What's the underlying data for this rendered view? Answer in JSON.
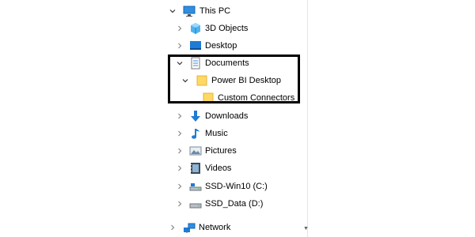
{
  "nav_tree": {
    "this_pc": "This PC",
    "items": [
      {
        "label": "3D Objects",
        "icon": "3d-objects-icon"
      },
      {
        "label": "Desktop",
        "icon": "desktop-icon"
      },
      {
        "label": "Documents",
        "icon": "documents-icon"
      },
      {
        "label": "Power BI Desktop",
        "icon": "folder-icon"
      },
      {
        "label": "Custom Connectors",
        "icon": "folder-icon"
      },
      {
        "label": "Downloads",
        "icon": "downloads-icon"
      },
      {
        "label": "Music",
        "icon": "music-icon"
      },
      {
        "label": "Pictures",
        "icon": "pictures-icon"
      },
      {
        "label": "Videos",
        "icon": "videos-icon"
      },
      {
        "label": "SSD-Win10 (C:)",
        "icon": "drive-c-icon"
      },
      {
        "label": "SSD_Data (D:)",
        "icon": "drive-d-icon"
      }
    ],
    "network": "Network"
  },
  "colors": {
    "highlight_border": "#000000",
    "folder": "#ffd866",
    "accent": "#1e7bd6"
  }
}
